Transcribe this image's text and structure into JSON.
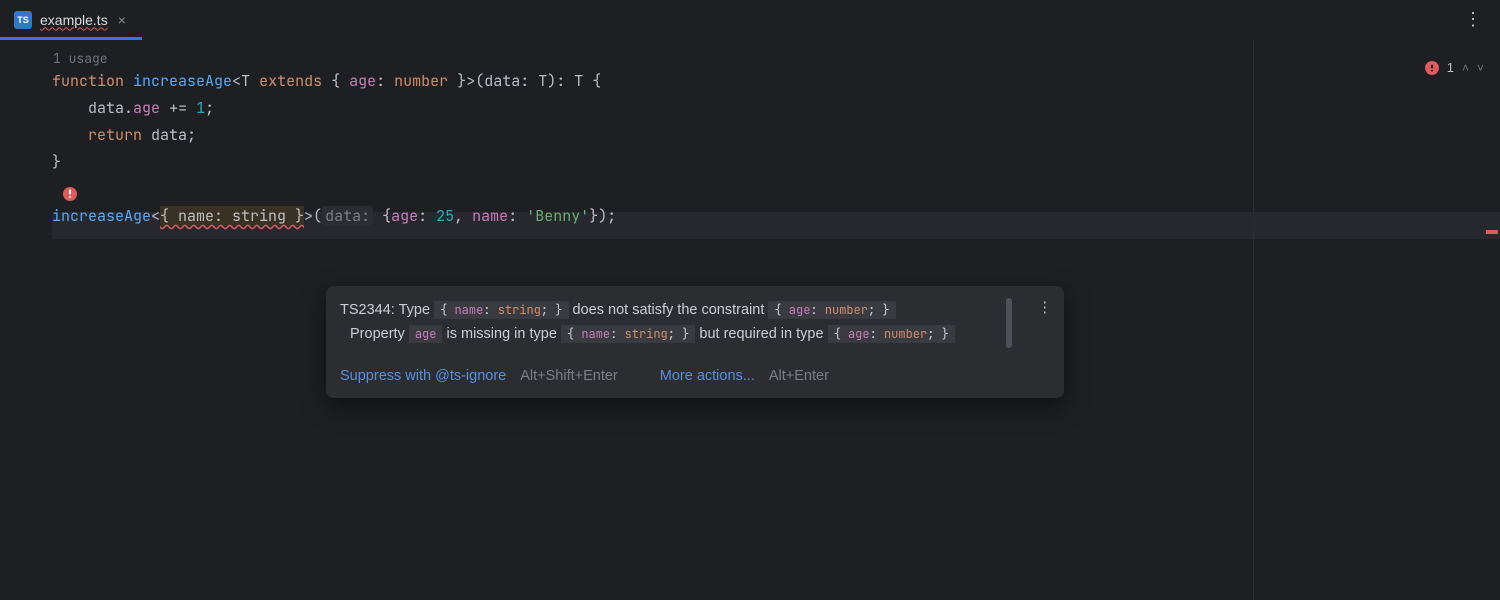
{
  "tab": {
    "badge": "TS",
    "filename": "example.ts",
    "close": "×"
  },
  "editor": {
    "usage_hint": "1 usage",
    "inlay_param": "data:",
    "tokens": {
      "kw_function": "function",
      "fn_name": "increaseAge",
      "type_T": "T",
      "kw_extends": "extends",
      "age": "age",
      "kw_number": "number",
      "param_data": "data",
      "kw_return": "return",
      "data_ident": "data",
      "line2_body": "data.age += ",
      "one": "1",
      "call_typearg": "{ name: string }",
      "obj_age_key": "age",
      "obj_age_val": "25",
      "obj_name_key": "name",
      "obj_name_val": "'Benny'"
    }
  },
  "tooltip": {
    "code": "TS2344",
    "msg_pre": ": Type ",
    "snip1_pre": "{ ",
    "snip1_name": "name",
    "snip1_mid": ": ",
    "snip1_type": "string",
    "snip1_post": "; }",
    "msg_mid": " does not satisfy the constraint ",
    "snip2_pre": "{ ",
    "snip2_name": "age",
    "snip2_mid": ": ",
    "snip2_type": "number",
    "snip2_post": "; }",
    "line2_pre": "Property ",
    "line2_prop": "age",
    "line2_mid": " is missing in type ",
    "line2_post": " but required in type ",
    "action_suppress": "Suppress with @ts-ignore",
    "shortcut_suppress": "Alt+Shift+Enter",
    "action_more": "More actions...",
    "shortcut_more": "Alt+Enter"
  },
  "errors": {
    "count": "1"
  }
}
